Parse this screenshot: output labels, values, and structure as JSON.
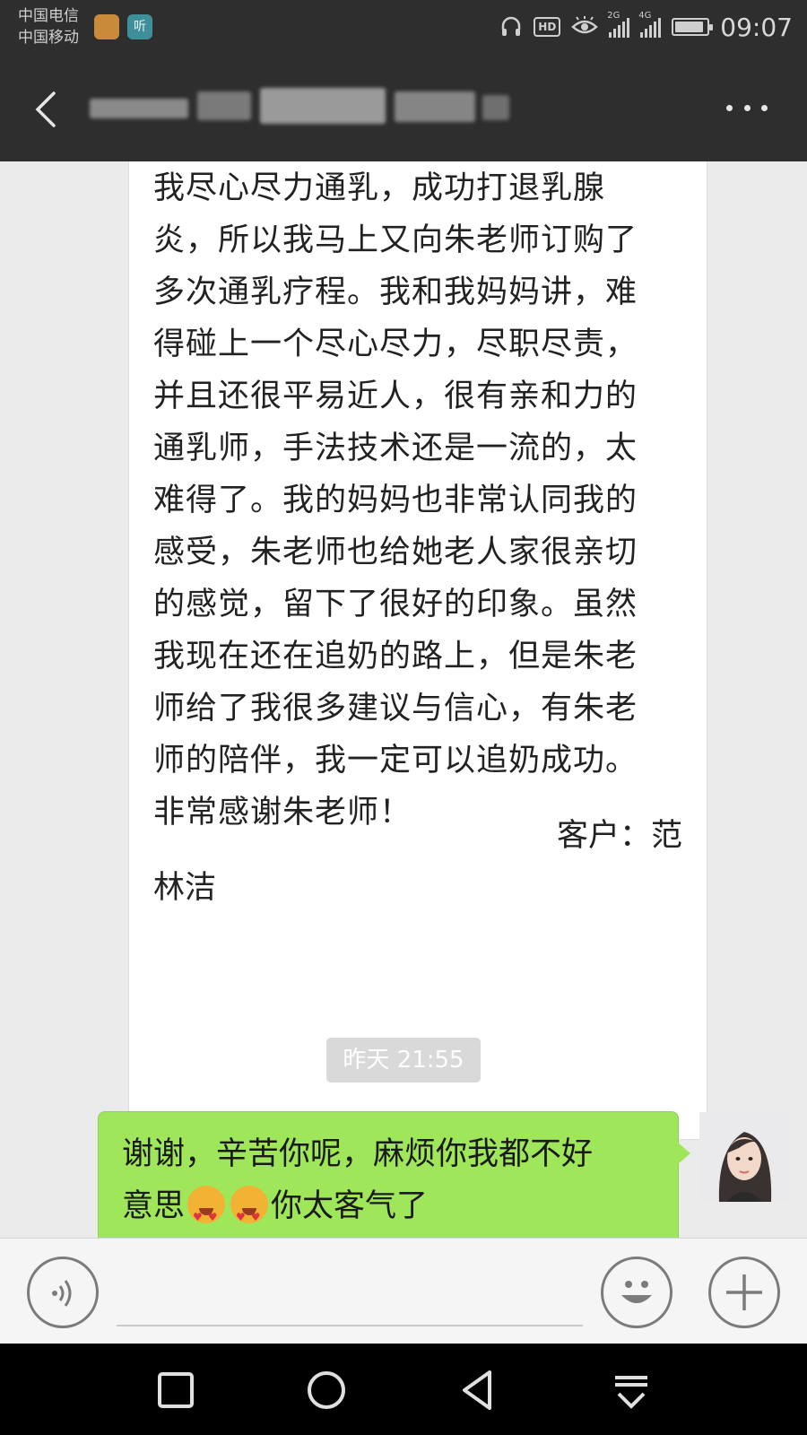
{
  "status_bar": {
    "carrier_1": "中国电信",
    "carrier_2": "中国移动",
    "app_badge_2": "听",
    "hd_label": "HD",
    "signal_1_label": "2G",
    "signal_2_label": "4G",
    "time": "09:07",
    "icons": [
      "headset-icon",
      "hd-icon",
      "eye-care-icon",
      "signal-2g-icon",
      "signal-4g-icon",
      "battery-icon"
    ]
  },
  "nav": {
    "back_icon": "chevron-left-icon",
    "more_icon": "more-dots-icon",
    "title_obscured": true
  },
  "messages": {
    "incoming": {
      "lines": [
        "我尽心尽力通乳，成功打退乳腺",
        "炎，所以我马上又向朱老师订购了",
        "多次通乳疗程。我和我妈妈讲，难",
        "得碰上一个尽心尽力，尽职尽责，",
        "并且还很平易近人，很有亲和力的",
        "通乳师，手法技术还是一流的，太",
        "难得了。我的妈妈也非常认同我的",
        "感受，朱老师也给她老人家很亲切",
        "的感觉，留下了很好的印象。虽然",
        "我现在还在追奶的路上，但是朱老",
        "师给了我很多建议与信心，有朱老",
        "师的陪伴，我一定可以追奶成功。",
        "非常感谢朱老师！"
      ],
      "sign_line_1": "客户：范",
      "sign_line_2": "林洁"
    },
    "timestamp": "昨天 21:55",
    "outgoing": {
      "line_1": "谢谢，辛苦你呢，麻烦你我都不好",
      "line_2_before": "意思",
      "line_2_after": "你太客气了",
      "emoji_name": "heart-eyes-emoji"
    }
  },
  "input_bar": {
    "voice_icon": "voice-input-icon",
    "emoji_icon": "smiley-icon",
    "plus_icon": "plus-icon",
    "text_value": ""
  },
  "system_nav": [
    "recent-apps-icon",
    "home-icon",
    "back-triangle-icon",
    "notification-pull-icon"
  ],
  "colors": {
    "header_bg": "#2e2e2e",
    "chat_bg": "#ebebeb",
    "outgoing_bubble": "#9fe65a",
    "incoming_bubble": "#ffffff"
  }
}
